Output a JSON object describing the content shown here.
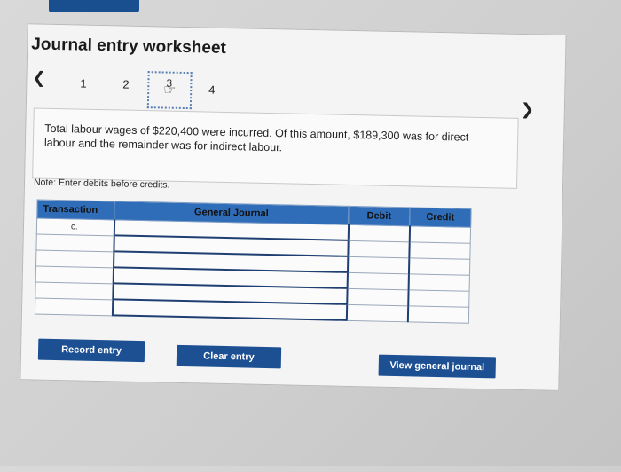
{
  "worksheet": {
    "title": "Journal entry worksheet",
    "steps": [
      "1",
      "2",
      "3",
      "4"
    ],
    "description": "Total labour wages of $220,400 were incurred. Of this amount, $189,300 was for direct labour and the remainder was for indirect labour.",
    "note": "Note: Enter debits before credits."
  },
  "table": {
    "headers": {
      "transaction": "Transaction",
      "general_journal": "General Journal",
      "debit": "Debit",
      "credit": "Credit"
    },
    "transaction_label": "c."
  },
  "buttons": {
    "record": "Record entry",
    "clear": "Clear entry",
    "view": "View general journal"
  },
  "colors": {
    "button_bg": "#1d4f93",
    "header_bg": "#2f6db8"
  },
  "icons": {
    "prev": "chevron-left-icon",
    "next": "chevron-right-icon",
    "cursor": "hand-pointer-icon"
  }
}
